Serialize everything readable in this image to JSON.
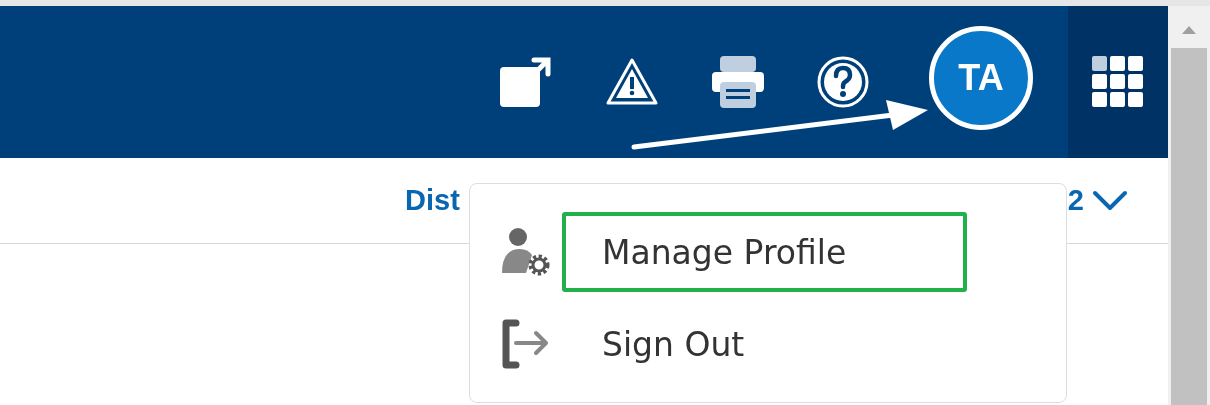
{
  "header": {
    "avatar": {
      "initials": "TA"
    }
  },
  "subheader": {
    "left_text": "Dist",
    "right_text": "2"
  },
  "user_menu": {
    "items": [
      {
        "label": "Manage Profile",
        "kind": "profile",
        "highlighted": true
      },
      {
        "label": "Sign Out",
        "kind": "signout",
        "highlighted": false
      }
    ]
  }
}
